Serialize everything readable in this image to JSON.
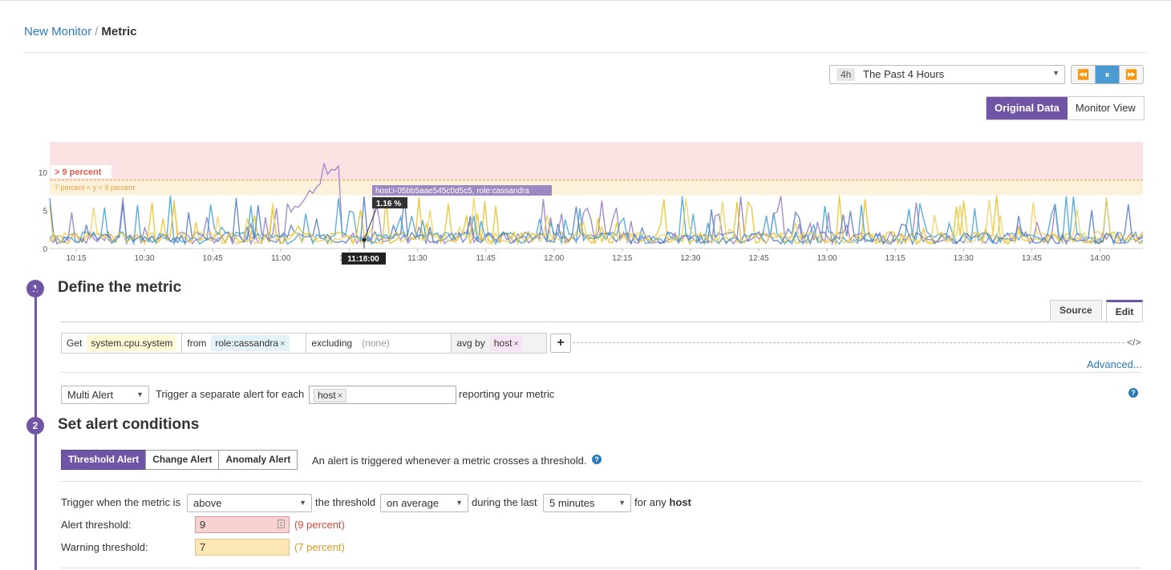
{
  "breadcrumb": {
    "parent": "New Monitor",
    "separator": "/",
    "current": "Metric"
  },
  "timeframe": {
    "badge": "4h",
    "label": "The Past 4 Hours"
  },
  "playback": {
    "rewind": "⏪",
    "pause": "⏸",
    "forward": "⏩"
  },
  "view_toggle": {
    "original": "Original Data",
    "monitor": "Monitor View"
  },
  "colors": {
    "accent": "#7055a6",
    "link": "#2a7ab8",
    "alert_zone": "#fbe3e3",
    "warn_zone": "#fdf1dc",
    "alert_text": "#e05a4f",
    "warn_text": "#e8a33c"
  },
  "chart_data": {
    "type": "line",
    "y_ticks": [
      "0",
      "5",
      "10"
    ],
    "ylim": [
      0,
      14
    ],
    "x_ticks": [
      "10:15",
      "10:30",
      "10:45",
      "11:00",
      "11:15",
      "11:30",
      "11:45",
      "12:00",
      "12:15",
      "12:30",
      "12:45",
      "13:00",
      "13:15",
      "13:30",
      "13:45",
      "14:00"
    ],
    "alert_label": "> 9 percent",
    "warn_label": "7 percent < y < 9 percent",
    "alert_threshold": 9,
    "warn_threshold": 7,
    "tooltip": {
      "host": "host:i-05bb5aae545c0d5c5, role:cassandra",
      "value": "1.16 %",
      "time": "11:18:00"
    },
    "series_colors": [
      "#9b7fc4",
      "#e8c32e",
      "#4aa6d6",
      "#5b83c7",
      "#f0d060"
    ]
  },
  "step1": {
    "number": "1",
    "title": "Define the metric"
  },
  "editor_tabs": {
    "source": "Source",
    "edit": "Edit"
  },
  "query": {
    "get_label": "Get",
    "metric": "system.cpu.system",
    "from_label": "from",
    "from_tag": "role:cassandra",
    "excluding_label": "excluding",
    "excluding_value": "(none)",
    "avg_label": "avg by",
    "avg_tag": "host",
    "remove": "×",
    "add": "+",
    "code_icon": "</>"
  },
  "advanced": "Advanced...",
  "multi_alert": {
    "select": "Multi Alert",
    "text": "Trigger a separate alert for each",
    "chip": "host",
    "suffix": "reporting your metric"
  },
  "step2": {
    "number": "2",
    "title": "Set alert conditions"
  },
  "alert_types": {
    "threshold": "Threshold Alert",
    "change": "Change Alert",
    "anomaly": "Anomaly Alert",
    "description": "An alert is triggered whenever a metric crosses a threshold."
  },
  "trigger": {
    "prefix": "Trigger when the metric is",
    "condition": "above",
    "mid": "the threshold",
    "aggregation": "on average",
    "during": "during the last",
    "window": "5 minutes",
    "suffix": "for any",
    "group": "host"
  },
  "thresholds": {
    "alert_label": "Alert threshold:",
    "alert_value": "9",
    "alert_hint": "(9 percent)",
    "warning_label": "Warning threshold:",
    "warning_value": "7",
    "warning_hint": "(7 percent)"
  }
}
